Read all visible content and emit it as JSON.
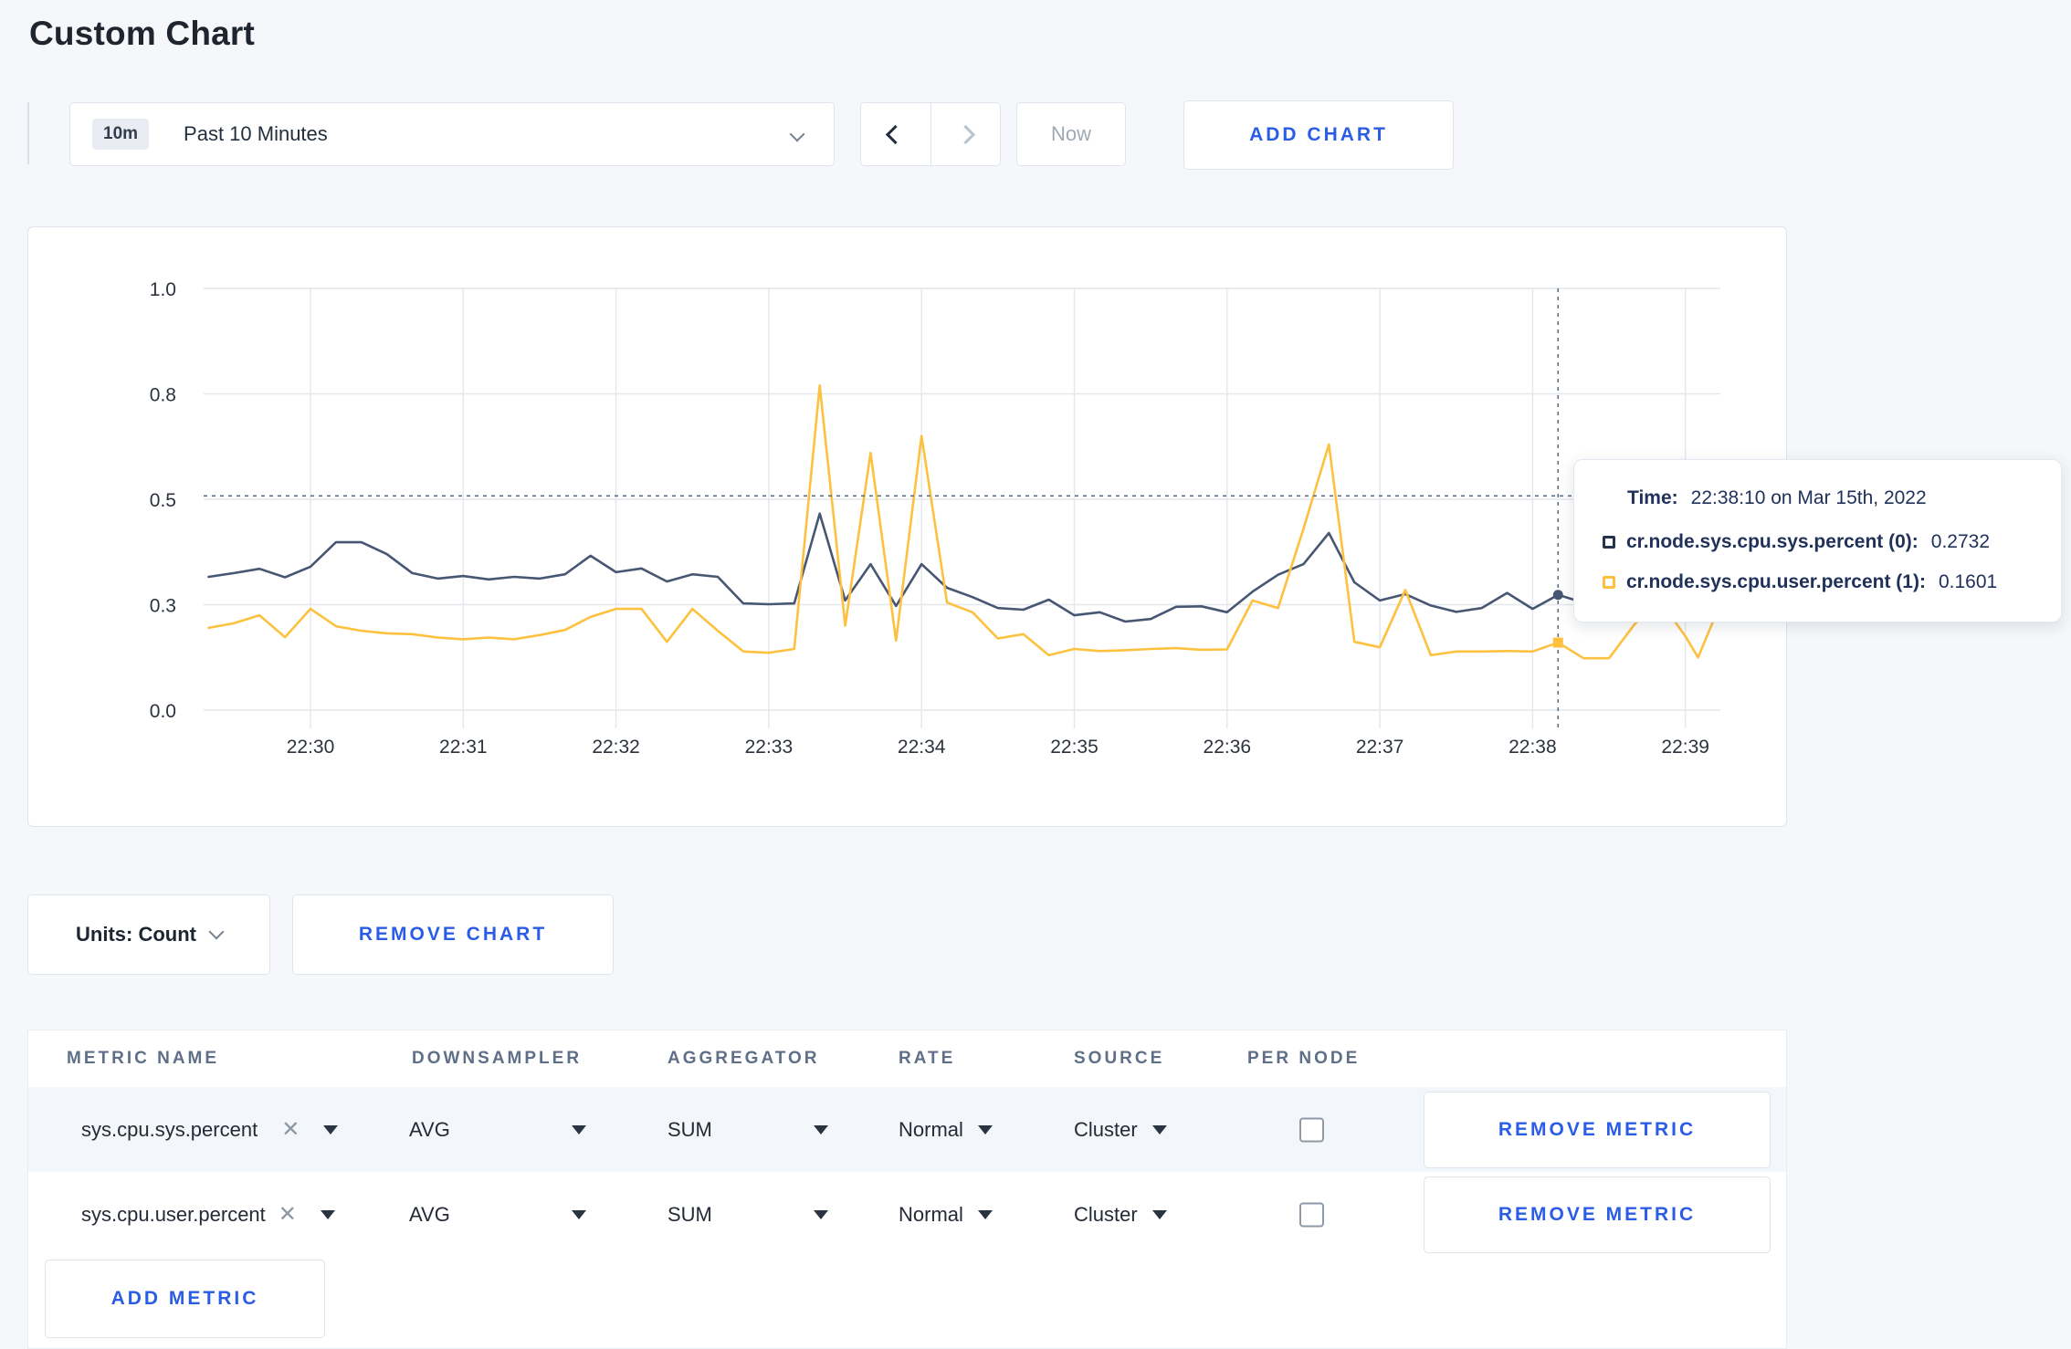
{
  "page": {
    "title": "Custom Chart",
    "bg": "#f5f7fa",
    "accent": "#2b5ce6"
  },
  "toolbar": {
    "time_badge": "10m",
    "time_label": "Past 10 Minutes",
    "now_label": "Now",
    "add_chart_label": "ADD CHART"
  },
  "chart_controls": {
    "units_label": "Units: Count",
    "remove_chart_label": "REMOVE CHART"
  },
  "tooltip": {
    "time_label": "Time:",
    "time_value": "22:38:10 on Mar 15th, 2022",
    "entries": [
      {
        "name": "cr.node.sys.cpu.sys.percent (0):",
        "value": "0.2732",
        "color": "#26334d"
      },
      {
        "name": "cr.node.sys.cpu.user.percent (1):",
        "value": "0.1601",
        "color": "#fdc13f"
      }
    ]
  },
  "metrics_table": {
    "columns": [
      "METRIC NAME",
      "DOWNSAMPLER",
      "AGGREGATOR",
      "RATE",
      "SOURCE",
      "PER NODE"
    ],
    "rows": [
      {
        "metric": "sys.cpu.sys.percent",
        "downsampler": "AVG",
        "aggregator": "SUM",
        "rate": "Normal",
        "source": "Cluster",
        "per_node": false,
        "remove_label": "REMOVE METRIC"
      },
      {
        "metric": "sys.cpu.user.percent",
        "downsampler": "AVG",
        "aggregator": "SUM",
        "rate": "Normal",
        "source": "Cluster",
        "per_node": false,
        "remove_label": "REMOVE METRIC"
      }
    ],
    "add_metric_label": "ADD METRIC"
  },
  "chart_data": {
    "type": "line",
    "title": "",
    "xlabel": "",
    "ylabel": "",
    "ylim": [
      0,
      1
    ],
    "grid": true,
    "legend_position": "tooltip",
    "x_ticks": [
      "22:30",
      "22:31",
      "22:32",
      "22:33",
      "22:34",
      "22:35",
      "22:36",
      "22:37",
      "22:38",
      "22:39"
    ],
    "y_ticks": [
      {
        "label": "0.0",
        "value": 0
      },
      {
        "label": "0.3",
        "value": 0.25
      },
      {
        "label": "0.5",
        "value": 0.5
      },
      {
        "label": "0.8",
        "value": 0.75
      },
      {
        "label": "1.0",
        "value": 1
      }
    ],
    "x_domain": [
      "22:29:18",
      "22:39:16"
    ],
    "crosshair": {
      "time": "22:38:10",
      "y_value": 0.508
    },
    "series": [
      {
        "name": "cr.node.sys.cpu.sys.percent",
        "color": "#475672",
        "marker": "circle",
        "points": [
          [
            "22:29:20",
            0.316
          ],
          [
            "22:29:30",
            0.325
          ],
          [
            "22:29:40",
            0.335
          ],
          [
            "22:29:50",
            0.315
          ],
          [
            "22:30:00",
            0.34
          ],
          [
            "22:30:10",
            0.398
          ],
          [
            "22:30:20",
            0.398
          ],
          [
            "22:30:30",
            0.37
          ],
          [
            "22:30:40",
            0.325
          ],
          [
            "22:30:50",
            0.312
          ],
          [
            "22:31:00",
            0.318
          ],
          [
            "22:31:10",
            0.31
          ],
          [
            "22:31:20",
            0.316
          ],
          [
            "22:31:30",
            0.312
          ],
          [
            "22:31:40",
            0.322
          ],
          [
            "22:31:50",
            0.366
          ],
          [
            "22:32:00",
            0.327
          ],
          [
            "22:32:10",
            0.336
          ],
          [
            "22:32:20",
            0.305
          ],
          [
            "22:32:30",
            0.322
          ],
          [
            "22:32:40",
            0.316
          ],
          [
            "22:32:50",
            0.253
          ],
          [
            "22:33:00",
            0.251
          ],
          [
            "22:33:10",
            0.253
          ],
          [
            "22:33:20",
            0.466
          ],
          [
            "22:33:30",
            0.26
          ],
          [
            "22:33:40",
            0.346
          ],
          [
            "22:33:50",
            0.247
          ],
          [
            "22:34:00",
            0.346
          ],
          [
            "22:34:10",
            0.29
          ],
          [
            "22:34:20",
            0.268
          ],
          [
            "22:34:30",
            0.242
          ],
          [
            "22:34:40",
            0.238
          ],
          [
            "22:34:50",
            0.262
          ],
          [
            "22:35:00",
            0.225
          ],
          [
            "22:35:10",
            0.232
          ],
          [
            "22:35:20",
            0.21
          ],
          [
            "22:35:30",
            0.216
          ],
          [
            "22:35:40",
            0.245
          ],
          [
            "22:35:50",
            0.246
          ],
          [
            "22:36:00",
            0.232
          ],
          [
            "22:36:10",
            0.281
          ],
          [
            "22:36:20",
            0.321
          ],
          [
            "22:36:30",
            0.346
          ],
          [
            "22:36:40",
            0.42
          ],
          [
            "22:36:50",
            0.303
          ],
          [
            "22:37:00",
            0.26
          ],
          [
            "22:37:10",
            0.275
          ],
          [
            "22:37:20",
            0.248
          ],
          [
            "22:37:30",
            0.233
          ],
          [
            "22:37:40",
            0.242
          ],
          [
            "22:37:50",
            0.278
          ],
          [
            "22:38:00",
            0.24
          ],
          [
            "22:38:10",
            0.2732
          ],
          [
            "22:38:20",
            0.255
          ],
          [
            "22:38:30",
            0.27
          ],
          [
            "22:38:40",
            0.26
          ],
          [
            "22:38:50",
            0.28
          ],
          [
            "22:39:00",
            0.29
          ],
          [
            "22:39:10",
            0.3
          ],
          [
            "22:39:15",
            0.3
          ]
        ]
      },
      {
        "name": "cr.node.sys.cpu.user.percent",
        "color": "#fdc13f",
        "marker": "square",
        "points": [
          [
            "22:29:20",
            0.195
          ],
          [
            "22:29:30",
            0.206
          ],
          [
            "22:29:40",
            0.225
          ],
          [
            "22:29:50",
            0.173
          ],
          [
            "22:30:00",
            0.24
          ],
          [
            "22:30:10",
            0.199
          ],
          [
            "22:30:20",
            0.188
          ],
          [
            "22:30:30",
            0.182
          ],
          [
            "22:30:40",
            0.18
          ],
          [
            "22:30:50",
            0.172
          ],
          [
            "22:31:00",
            0.168
          ],
          [
            "22:31:10",
            0.172
          ],
          [
            "22:31:20",
            0.168
          ],
          [
            "22:31:30",
            0.178
          ],
          [
            "22:31:40",
            0.19
          ],
          [
            "22:31:50",
            0.221
          ],
          [
            "22:32:00",
            0.24
          ],
          [
            "22:32:10",
            0.24
          ],
          [
            "22:32:20",
            0.162
          ],
          [
            "22:32:30",
            0.24
          ],
          [
            "22:32:40",
            0.188
          ],
          [
            "22:32:50",
            0.139
          ],
          [
            "22:33:00",
            0.136
          ],
          [
            "22:33:10",
            0.145
          ],
          [
            "22:33:20",
            0.77
          ],
          [
            "22:33:30",
            0.2
          ],
          [
            "22:33:40",
            0.61
          ],
          [
            "22:33:50",
            0.165
          ],
          [
            "22:34:00",
            0.65
          ],
          [
            "22:34:10",
            0.255
          ],
          [
            "22:34:20",
            0.232
          ],
          [
            "22:34:30",
            0.17
          ],
          [
            "22:34:40",
            0.18
          ],
          [
            "22:34:50",
            0.13
          ],
          [
            "22:35:00",
            0.145
          ],
          [
            "22:35:10",
            0.14
          ],
          [
            "22:35:20",
            0.142
          ],
          [
            "22:35:30",
            0.145
          ],
          [
            "22:35:40",
            0.147
          ],
          [
            "22:35:50",
            0.143
          ],
          [
            "22:36:00",
            0.144
          ],
          [
            "22:36:10",
            0.26
          ],
          [
            "22:36:20",
            0.242
          ],
          [
            "22:36:30",
            0.43
          ],
          [
            "22:36:40",
            0.63
          ],
          [
            "22:36:50",
            0.162
          ],
          [
            "22:37:00",
            0.149
          ],
          [
            "22:37:10",
            0.285
          ],
          [
            "22:37:20",
            0.13
          ],
          [
            "22:37:30",
            0.139
          ],
          [
            "22:37:40",
            0.139
          ],
          [
            "22:37:50",
            0.14
          ],
          [
            "22:38:00",
            0.139
          ],
          [
            "22:38:10",
            0.1601
          ],
          [
            "22:38:20",
            0.123
          ],
          [
            "22:38:30",
            0.123
          ],
          [
            "22:38:40",
            0.203
          ],
          [
            "22:38:50",
            0.26
          ],
          [
            "22:39:00",
            0.175
          ],
          [
            "22:39:05",
            0.125
          ],
          [
            "22:39:15",
            0.27
          ]
        ]
      }
    ]
  }
}
